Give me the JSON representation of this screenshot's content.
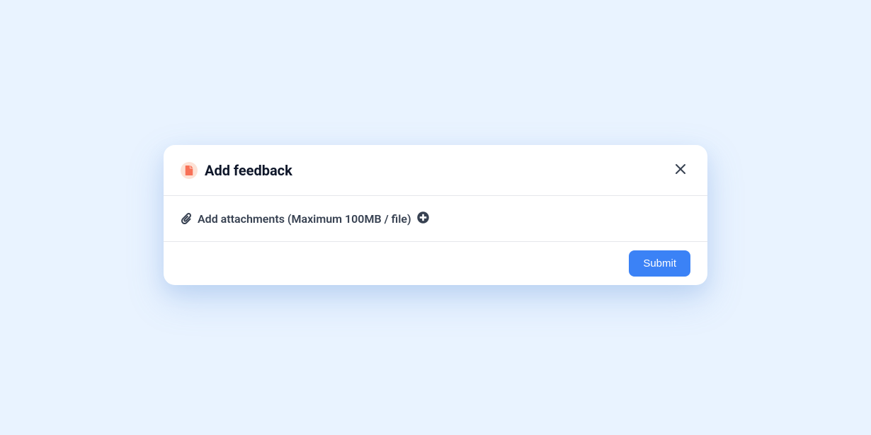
{
  "modal": {
    "title": "Add feedback",
    "attachments_label": "Add attachments (Maximum 100MB / file)",
    "submit_label": "Submit"
  }
}
